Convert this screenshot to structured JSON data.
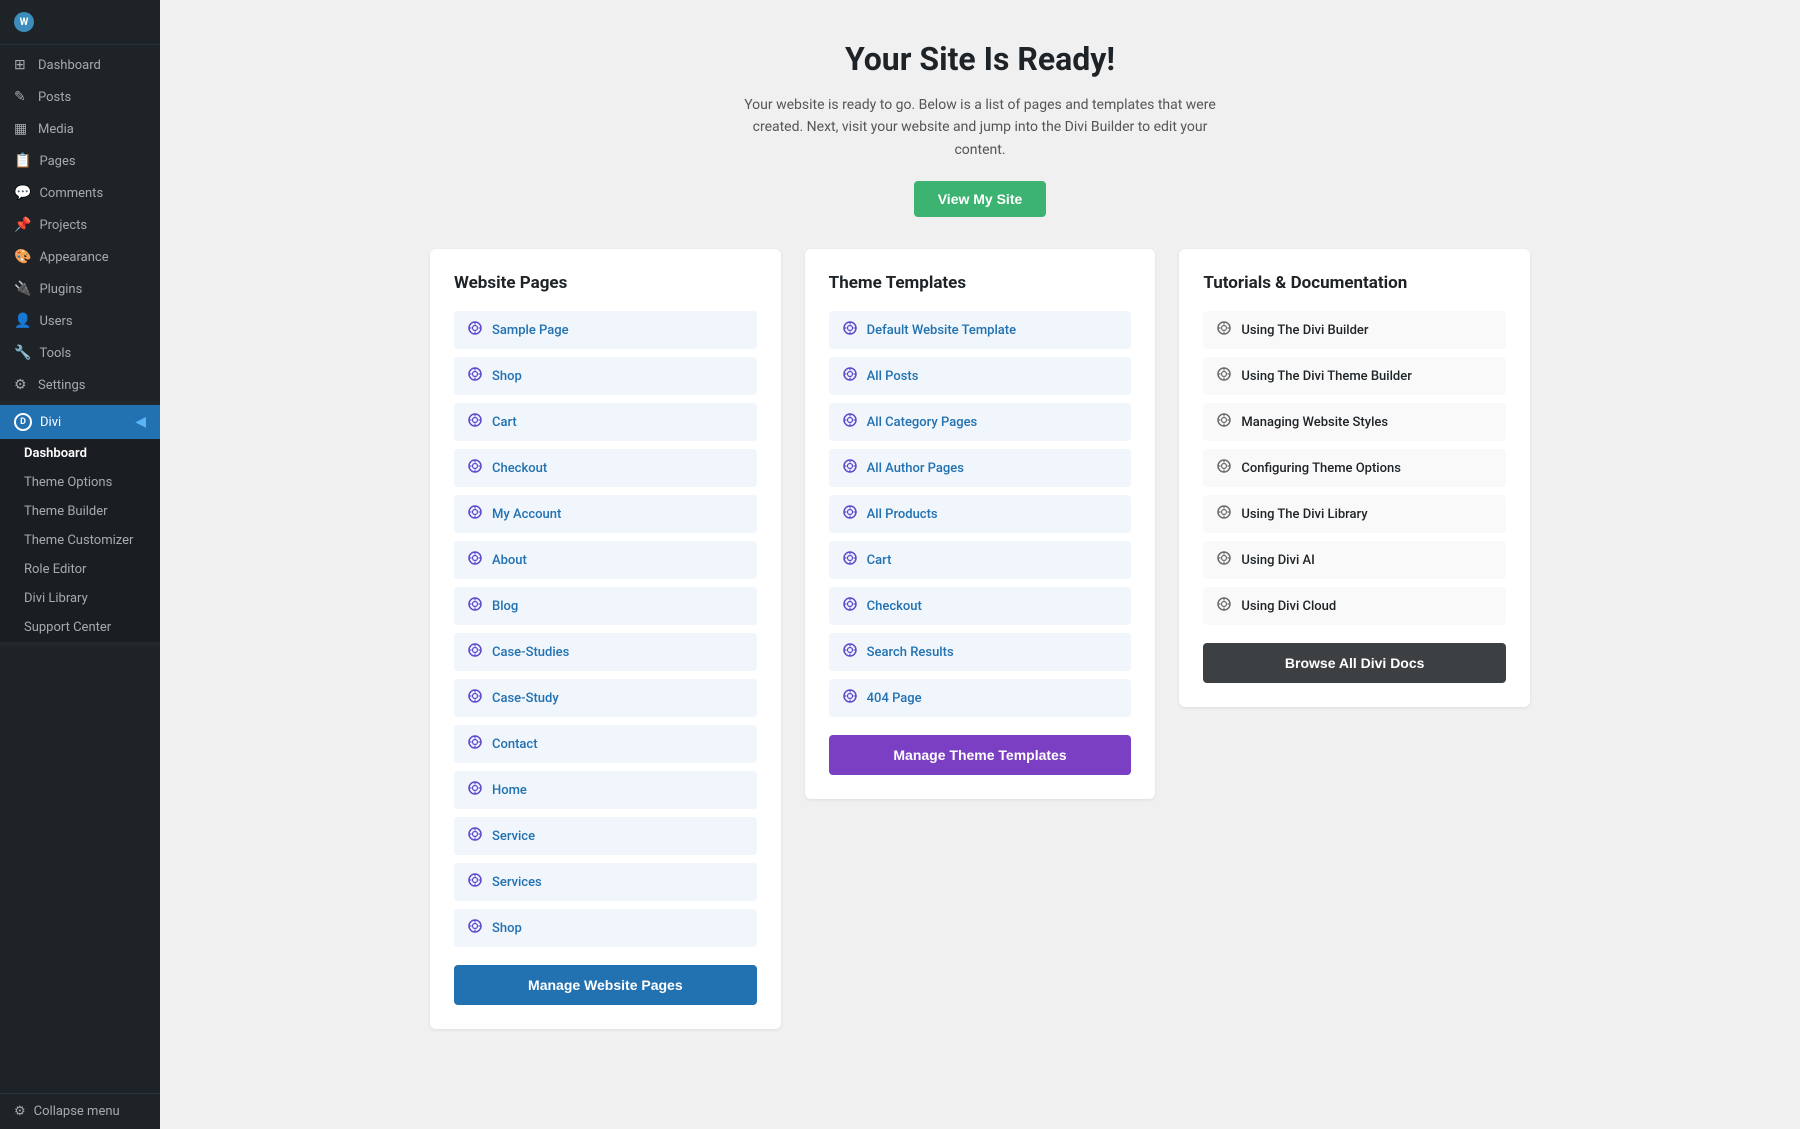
{
  "sidebar": {
    "logo_label": "W",
    "items": [
      {
        "id": "dashboard",
        "label": "Dashboard",
        "icon": "⊞"
      },
      {
        "id": "posts",
        "label": "Posts",
        "icon": "📄"
      },
      {
        "id": "media",
        "label": "Media",
        "icon": "🖼"
      },
      {
        "id": "pages",
        "label": "Pages",
        "icon": "📋"
      },
      {
        "id": "comments",
        "label": "Comments",
        "icon": "💬"
      },
      {
        "id": "projects",
        "label": "Projects",
        "icon": "📌"
      },
      {
        "id": "appearance",
        "label": "Appearance",
        "icon": "🎨"
      },
      {
        "id": "plugins",
        "label": "Plugins",
        "icon": "🔌"
      },
      {
        "id": "users",
        "label": "Users",
        "icon": "👤"
      },
      {
        "id": "tools",
        "label": "Tools",
        "icon": "🔧"
      },
      {
        "id": "settings",
        "label": "Settings",
        "icon": "⚙"
      }
    ],
    "divi_label": "Divi",
    "divi_submenu": [
      {
        "id": "dashboard-sub",
        "label": "Dashboard",
        "active": true
      },
      {
        "id": "theme-options",
        "label": "Theme Options"
      },
      {
        "id": "theme-builder",
        "label": "Theme Builder"
      },
      {
        "id": "theme-customizer",
        "label": "Theme Customizer"
      },
      {
        "id": "role-editor",
        "label": "Role Editor"
      },
      {
        "id": "divi-library",
        "label": "Divi Library"
      },
      {
        "id": "support-center",
        "label": "Support Center"
      }
    ],
    "collapse_label": "Collapse menu"
  },
  "main": {
    "title": "Your Site Is Ready!",
    "subtitle": "Your website is ready to go. Below is a list of pages and templates that were created. Next, visit your website and jump into the Divi Builder to edit your content.",
    "view_site_btn": "View My Site",
    "website_pages": {
      "title": "Website Pages",
      "items": [
        "Sample Page",
        "Shop",
        "Cart",
        "Checkout",
        "My Account",
        "About",
        "Blog",
        "Case-Studies",
        "Case-Study",
        "Contact",
        "Home",
        "Service",
        "Services",
        "Shop"
      ],
      "btn_label": "Manage Website Pages"
    },
    "theme_templates": {
      "title": "Theme Templates",
      "items": [
        "Default Website Template",
        "All Posts",
        "All Category Pages",
        "All Author Pages",
        "All Products",
        "Cart",
        "Checkout",
        "Search Results",
        "404 Page"
      ],
      "btn_label": "Manage Theme Templates"
    },
    "tutorials": {
      "title": "Tutorials & Documentation",
      "items": [
        "Using The Divi Builder",
        "Using The Divi Theme Builder",
        "Managing Website Styles",
        "Configuring Theme Options",
        "Using The Divi Library",
        "Using Divi AI",
        "Using Divi Cloud"
      ],
      "btn_label": "Browse All Divi Docs"
    }
  }
}
